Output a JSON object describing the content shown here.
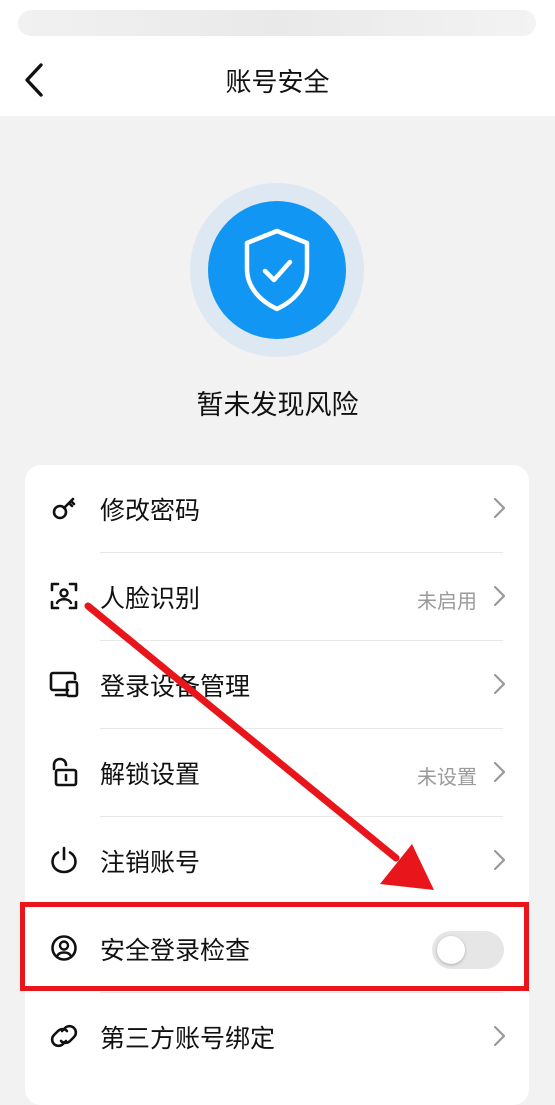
{
  "header": {
    "title": "账号安全",
    "back_icon": "chevron-left-icon"
  },
  "status": {
    "text": "暂未发现风险",
    "icon": "shield-check-icon",
    "accent_color": "#1196f3"
  },
  "menu": {
    "items": [
      {
        "label": "修改密码",
        "value": "",
        "icon": "key-icon"
      },
      {
        "label": "人脸识别",
        "value": "未启用",
        "icon": "face-scan-icon"
      },
      {
        "label": "登录设备管理",
        "value": "",
        "icon": "devices-icon"
      },
      {
        "label": "解锁设置",
        "value": "未设置",
        "icon": "unlock-icon"
      },
      {
        "label": "注销账号",
        "value": "",
        "icon": "power-icon"
      },
      {
        "label": "安全登录检查",
        "icon": "user-circle-icon",
        "toggle_on": false
      },
      {
        "label": "第三方账号绑定",
        "value": "",
        "icon": "link-icon"
      }
    ]
  },
  "annotation": {
    "color": "#e8151b",
    "target": "安全登录检查"
  }
}
